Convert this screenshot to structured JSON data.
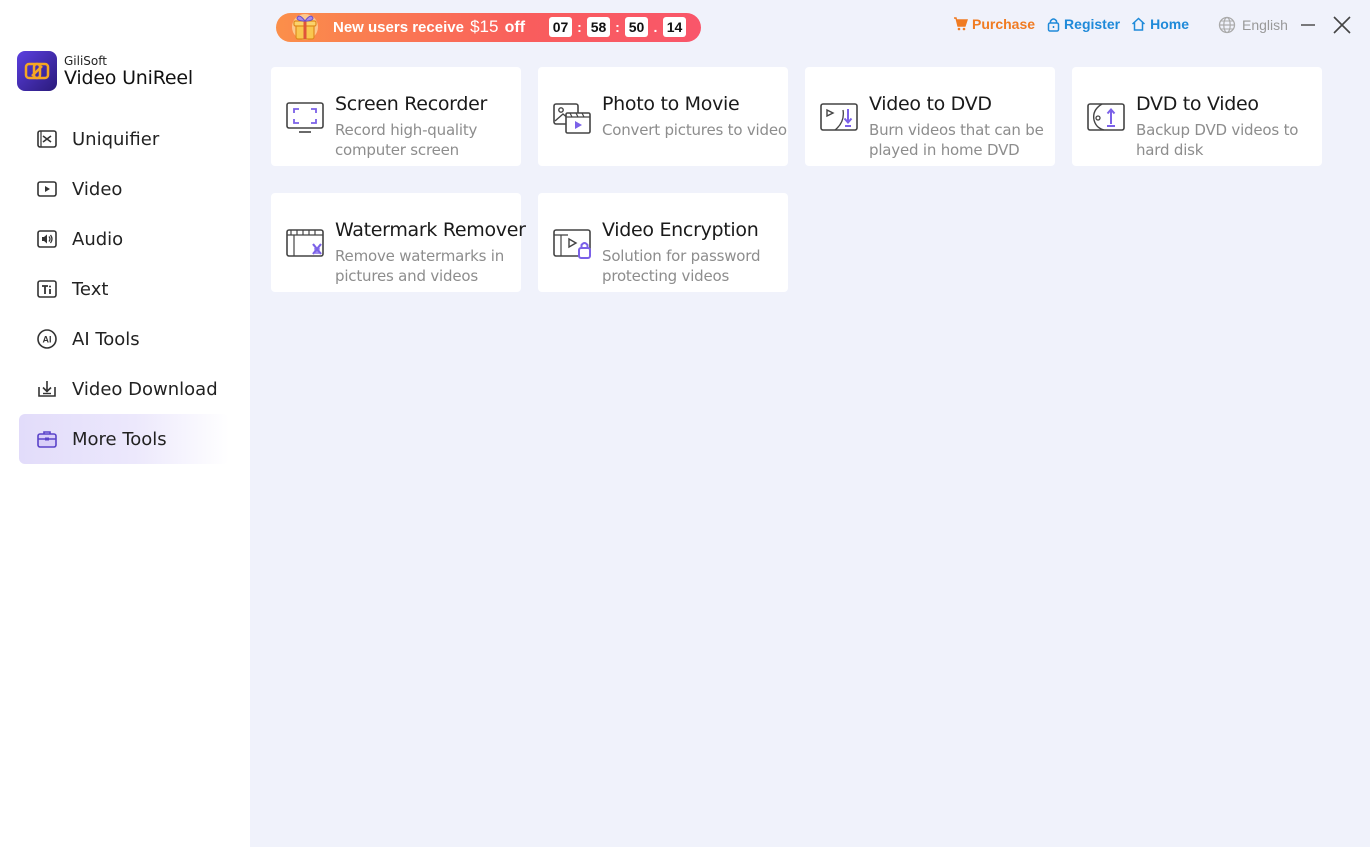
{
  "app": {
    "brand": "GiliSoft",
    "name": "Video UniReel"
  },
  "sidebar": {
    "items": [
      {
        "label": "Uniquifier",
        "icon": "uniquifier-icon"
      },
      {
        "label": "Video",
        "icon": "video-play-icon"
      },
      {
        "label": "Audio",
        "icon": "audio-speaker-icon"
      },
      {
        "label": "Text",
        "icon": "text-icon"
      },
      {
        "label": "AI Tools",
        "icon": "ai-icon"
      },
      {
        "label": "Video Download",
        "icon": "download-icon"
      },
      {
        "label": "More Tools",
        "icon": "toolbox-icon",
        "active": true
      }
    ]
  },
  "promo": {
    "text": "New users receive",
    "amount": "$15",
    "suffix": "off",
    "timer": [
      "07",
      "58",
      "50",
      "14"
    ],
    "separators": [
      ":",
      ":",
      "."
    ]
  },
  "header": {
    "purchase": "Purchase",
    "register": "Register",
    "home": "Home",
    "language": "English"
  },
  "tools": [
    {
      "title": "Screen Recorder",
      "desc": "Record high-quality computer screen"
    },
    {
      "title": "Photo to Movie",
      "desc": "Convert pictures to video"
    },
    {
      "title": "Video to DVD",
      "desc": "Burn videos that can be played in home DVD"
    },
    {
      "title": "DVD to Video",
      "desc": "Backup DVD videos to hard disk"
    },
    {
      "title": "Watermark Remover",
      "desc": "Remove watermarks in pictures and videos"
    },
    {
      "title": "Video Encryption",
      "desc": "Solution for password protecting videos"
    }
  ],
  "colors": {
    "accent": "#7b61e8",
    "purchase": "#f07b22",
    "link": "#1f8ad9",
    "background": "#f0f2fb"
  }
}
